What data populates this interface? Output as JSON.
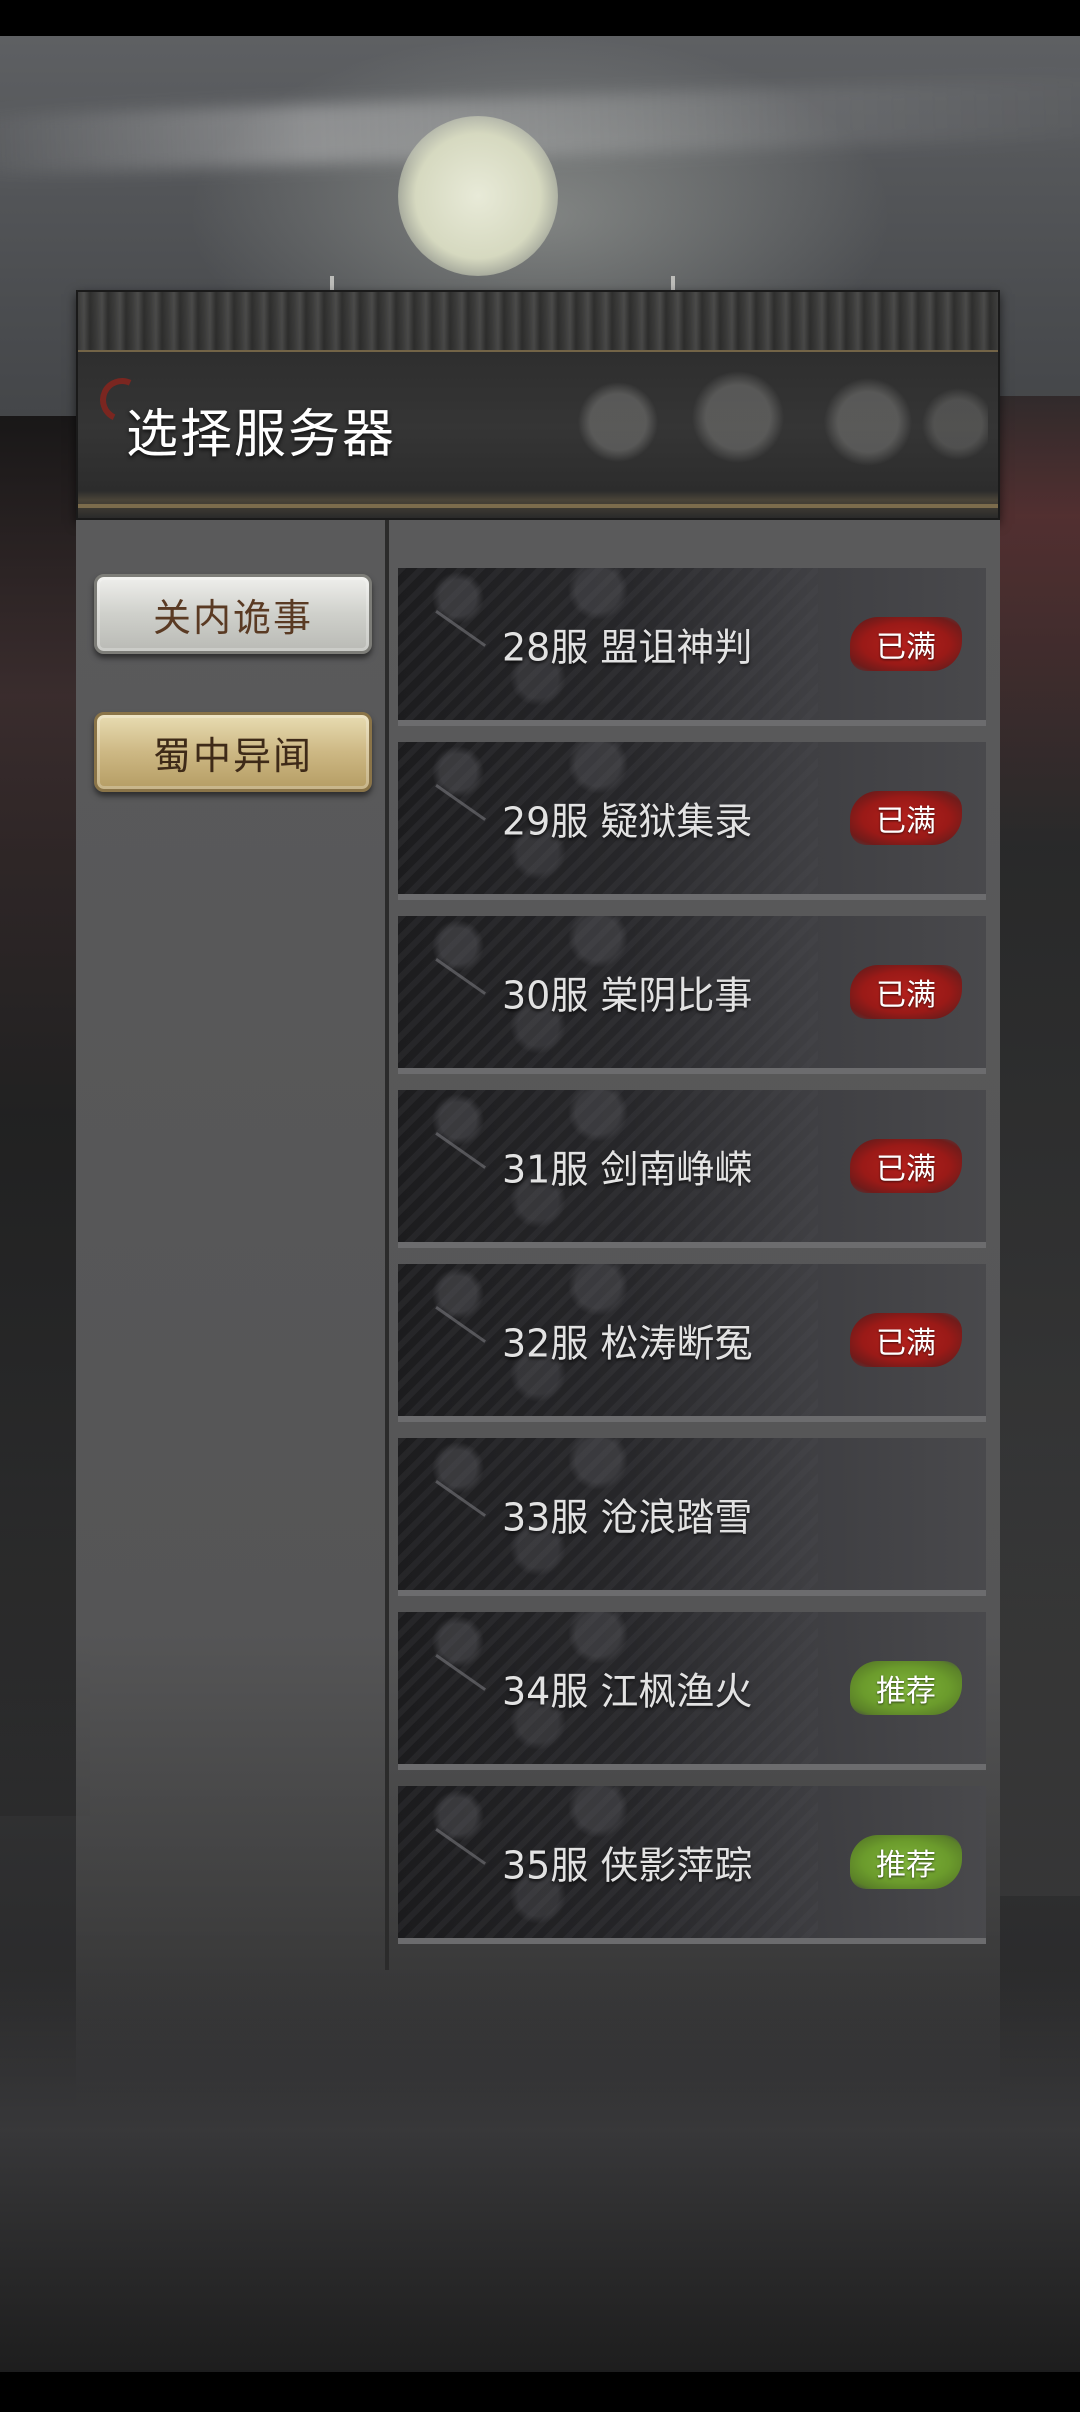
{
  "panel": {
    "title": "选择服务器"
  },
  "categories": [
    {
      "label": "关内诡事",
      "selected": false
    },
    {
      "label": "蜀中异闻",
      "selected": true
    }
  ],
  "servers": [
    {
      "name": "28服  盟诅神判",
      "badge": "已满",
      "status": "full"
    },
    {
      "name": "29服  疑狱集录",
      "badge": "已满",
      "status": "full"
    },
    {
      "name": "30服  棠阴比事",
      "badge": "已满",
      "status": "full"
    },
    {
      "name": "31服  剑南峥嵘",
      "badge": "已满",
      "status": "full"
    },
    {
      "name": "32服  松涛断冤",
      "badge": "已满",
      "status": "full"
    },
    {
      "name": "33服  沧浪踏雪",
      "badge": "",
      "status": "none"
    },
    {
      "name": "34服  江枫渔火",
      "badge": "推荐",
      "status": "rec"
    },
    {
      "name": "35服  侠影萍踪",
      "badge": "推荐",
      "status": "rec"
    }
  ],
  "colors": {
    "full_badge": "#b3201c",
    "recommended_badge": "#7fb33a",
    "selected_category": "#cdb884"
  }
}
